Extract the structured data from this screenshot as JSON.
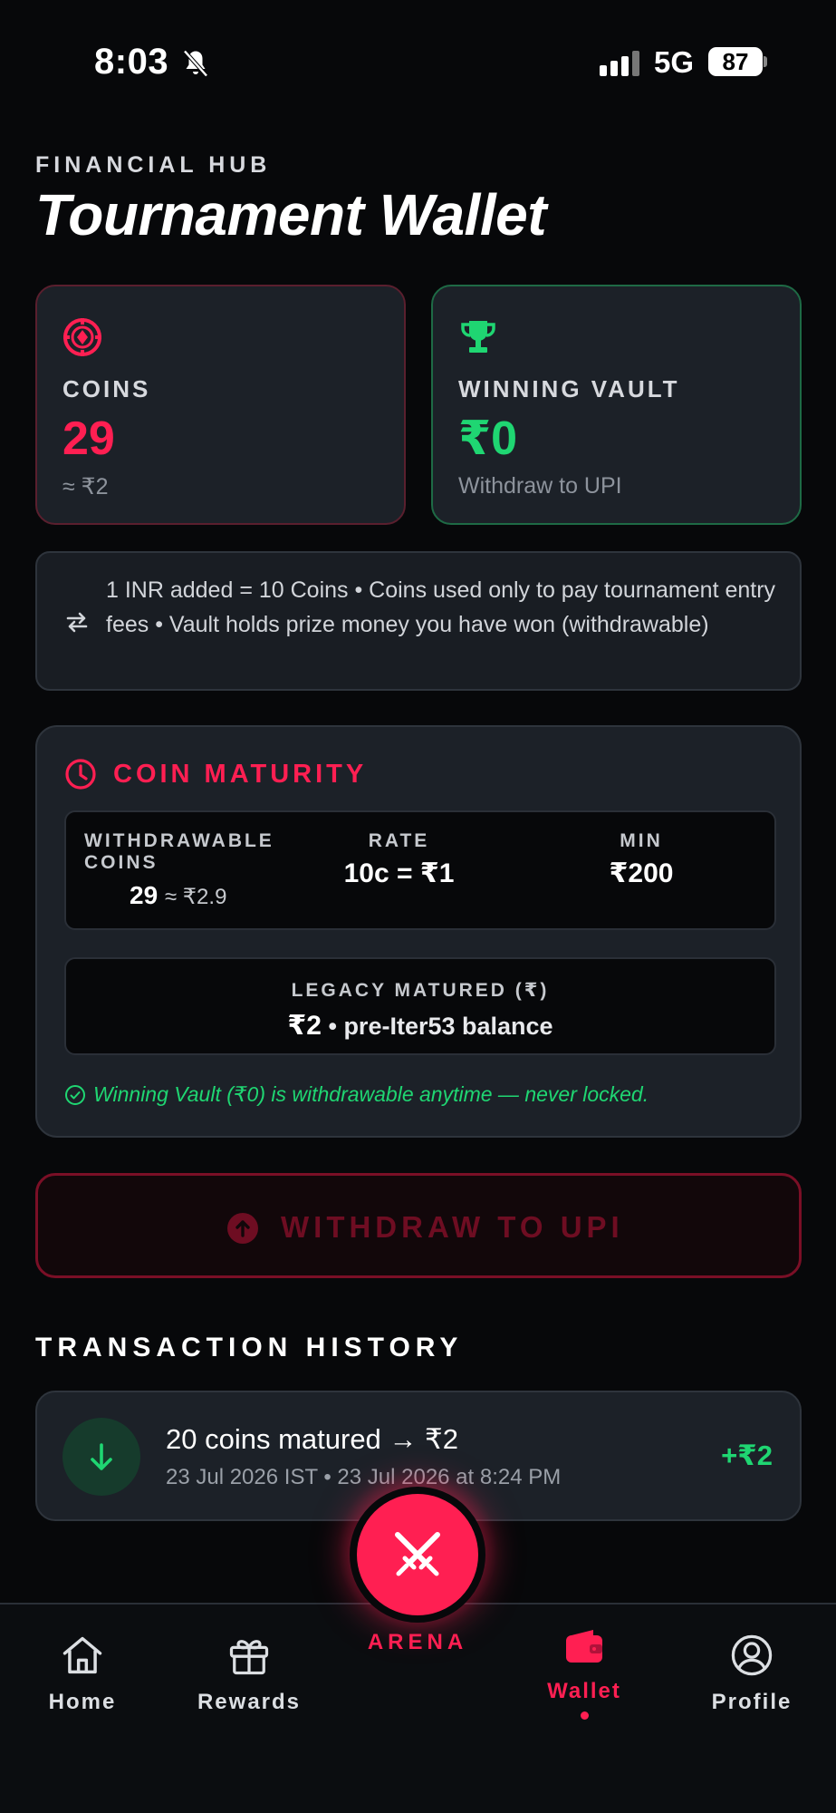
{
  "status_bar": {
    "time": "8:03",
    "network": "5G",
    "battery": "87"
  },
  "header": {
    "eyebrow": "FINANCIAL HUB",
    "title": "Tournament Wallet"
  },
  "cards": {
    "coins": {
      "label": "COINS",
      "value": "29",
      "sub": "≈ ₹2"
    },
    "vault": {
      "label": "WINNING VAULT",
      "value": "₹0",
      "sub": "Withdraw to UPI"
    }
  },
  "info": {
    "text": "1 INR added = 10 Coins • Coins used only to pay tournament entry fees • Vault holds prize money you have won (withdrawable)"
  },
  "maturity": {
    "title": "COIN MATURITY",
    "withdrawable_label_1": "WITHDRAWABLE",
    "withdrawable_label_2": "COINS",
    "withdrawable_value": "29",
    "withdrawable_approx": "≈ ₹2.9",
    "rate_label": "RATE",
    "rate_value": "10c = ₹1",
    "min_label": "MIN",
    "min_value": "₹200",
    "legacy_label": "LEGACY MATURED (₹)",
    "legacy_value": "₹2",
    "legacy_note": " • pre-Iter53 balance",
    "note": "Winning Vault (₹0) is withdrawable anytime — never locked."
  },
  "withdraw_button": {
    "label": "WITHDRAW TO UPI"
  },
  "history": {
    "title": "TRANSACTION HISTORY",
    "transactions": [
      {
        "title": "20 coins matured → ₹2",
        "subtitle": "23 Jul 2026 IST • 23 Jul 2026 at 8:24 PM",
        "amount": "+₹2"
      }
    ]
  },
  "nav": {
    "home": "Home",
    "rewards": "Rewards",
    "arena": "ARENA",
    "wallet": "Wallet",
    "profile": "Profile"
  },
  "colors": {
    "accent": "#ff1f52",
    "success": "#1fd672",
    "background": "#07080a",
    "card": "#1c2128"
  },
  "icons": {
    "coins": "poker-chip-icon",
    "vault": "trophy-icon",
    "info": "swap-arrows-icon",
    "maturity": "clock-icon",
    "note": "check-circle-icon",
    "withdraw": "arrow-up-circle-icon",
    "transaction": "arrow-down-icon",
    "arena": "crossed-swords-icon"
  }
}
